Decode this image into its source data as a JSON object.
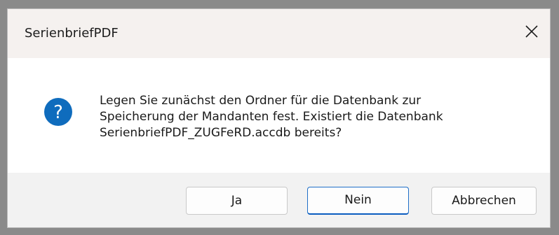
{
  "dialog": {
    "title": "SerienbriefPDF",
    "close_icon": "close-icon",
    "question_icon": "question-icon",
    "accent_color": "#0f6cbd",
    "message_lines": [
      "Legen Sie zunächst den Ordner für die Datenbank zur",
      "Speicherung der Mandanten fest. Existiert die Datenbank",
      "SerienbriefPDF_ZUGFeRD.accdb bereits?"
    ],
    "buttons": {
      "yes_label": "Ja",
      "no_label": "Nein",
      "cancel_label": "Abbrechen"
    },
    "default_button": "Nein"
  }
}
